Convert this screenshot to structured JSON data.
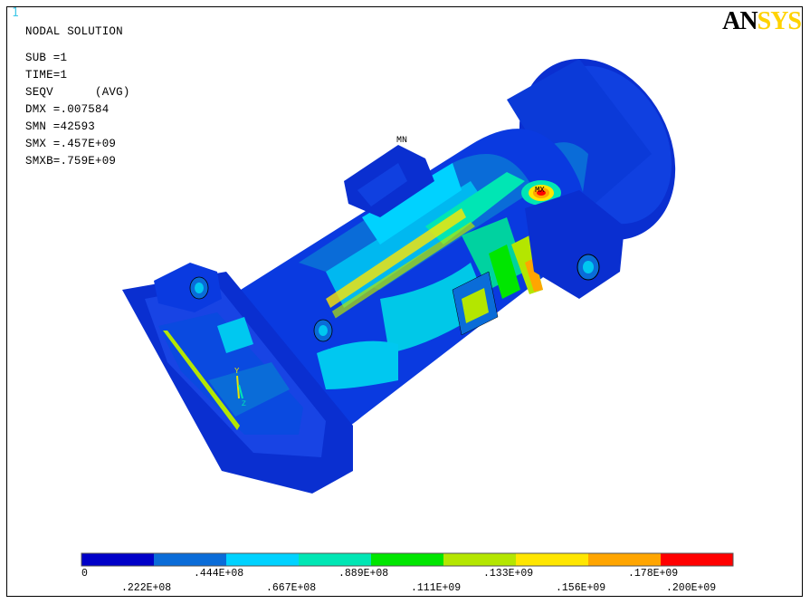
{
  "window_number": "1",
  "logo": {
    "left": "AN",
    "right": "SYS"
  },
  "info": {
    "title": "NODAL SOLUTION",
    "lines": [
      "SUB =1",
      "TIME=1",
      "SEQV      (AVG)",
      "DMX =.007584",
      "SMN =42593",
      "SMX =.457E+09",
      "SMXB=.759E+09"
    ]
  },
  "markers": {
    "min": "MN",
    "max": "MX"
  },
  "axis_triad": {
    "y": "Y",
    "z": "Z"
  },
  "legend": {
    "colors": [
      "#0000c8",
      "#0a6cd8",
      "#00d2ff",
      "#00e6b4",
      "#00e600",
      "#b4e600",
      "#ffe600",
      "#ffa500",
      "#ff0000"
    ],
    "top_labels": [
      "0",
      ".444E+08",
      ".889E+08",
      ".133E+09",
      ".178E+09"
    ],
    "bottom_labels": [
      ".222E+08",
      ".667E+08",
      ".111E+09",
      ".156E+09",
      ".200E+09"
    ]
  }
}
